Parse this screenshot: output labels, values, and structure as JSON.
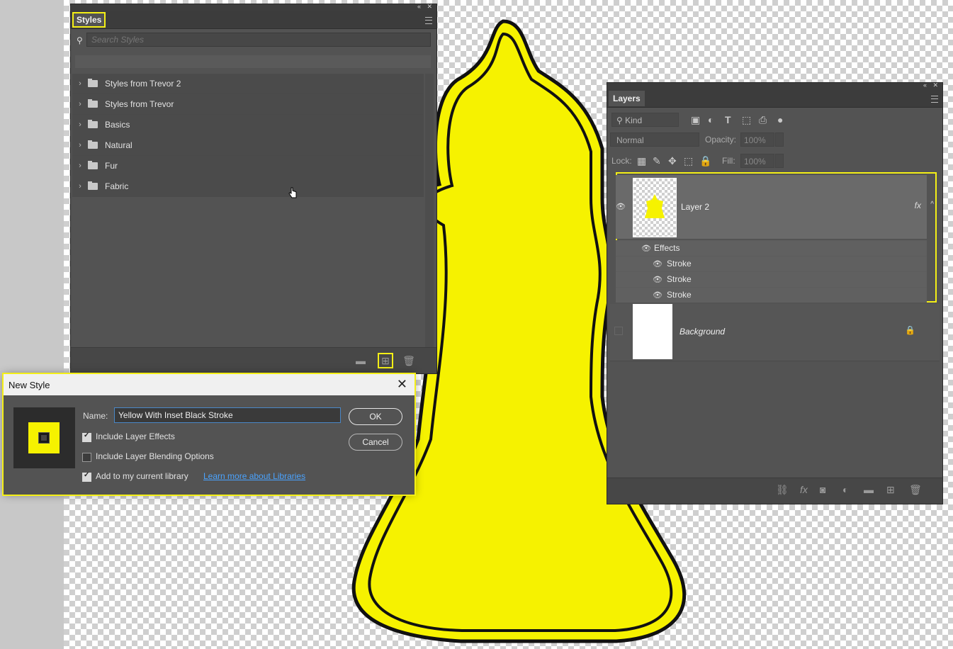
{
  "styles_panel": {
    "tab": "Styles",
    "search_placeholder": "Search Styles",
    "groups": [
      {
        "label": "Styles from Trevor 2"
      },
      {
        "label": "Styles from Trevor"
      },
      {
        "label": "Basics"
      },
      {
        "label": "Natural"
      },
      {
        "label": "Fur"
      },
      {
        "label": "Fabric"
      }
    ]
  },
  "layers_panel": {
    "tab": "Layers",
    "kind": "Kind",
    "blend_mode": "Normal",
    "opacity_label": "Opacity:",
    "opacity_value": "100%",
    "lock_label": "Lock:",
    "fill_label": "Fill:",
    "fill_value": "100%",
    "layer2": {
      "name": "Layer 2",
      "fx": "fx",
      "effects_label": "Effects",
      "effects": [
        "Stroke",
        "Stroke",
        "Stroke"
      ]
    },
    "background": {
      "name": "Background"
    }
  },
  "new_style_dialog": {
    "title": "New Style",
    "name_label": "Name:",
    "name_value": "Yellow With Inset Black Stroke",
    "include_effects": "Include Layer Effects",
    "include_blending": "Include Layer Blending Options",
    "add_library": "Add to my current library",
    "learn_more": "Learn more about Libraries",
    "ok": "OK",
    "cancel": "Cancel"
  },
  "colors": {
    "accent_highlight": "#f4ef16",
    "shape_fill": "#f6f200",
    "panel_bg": "#535353"
  }
}
